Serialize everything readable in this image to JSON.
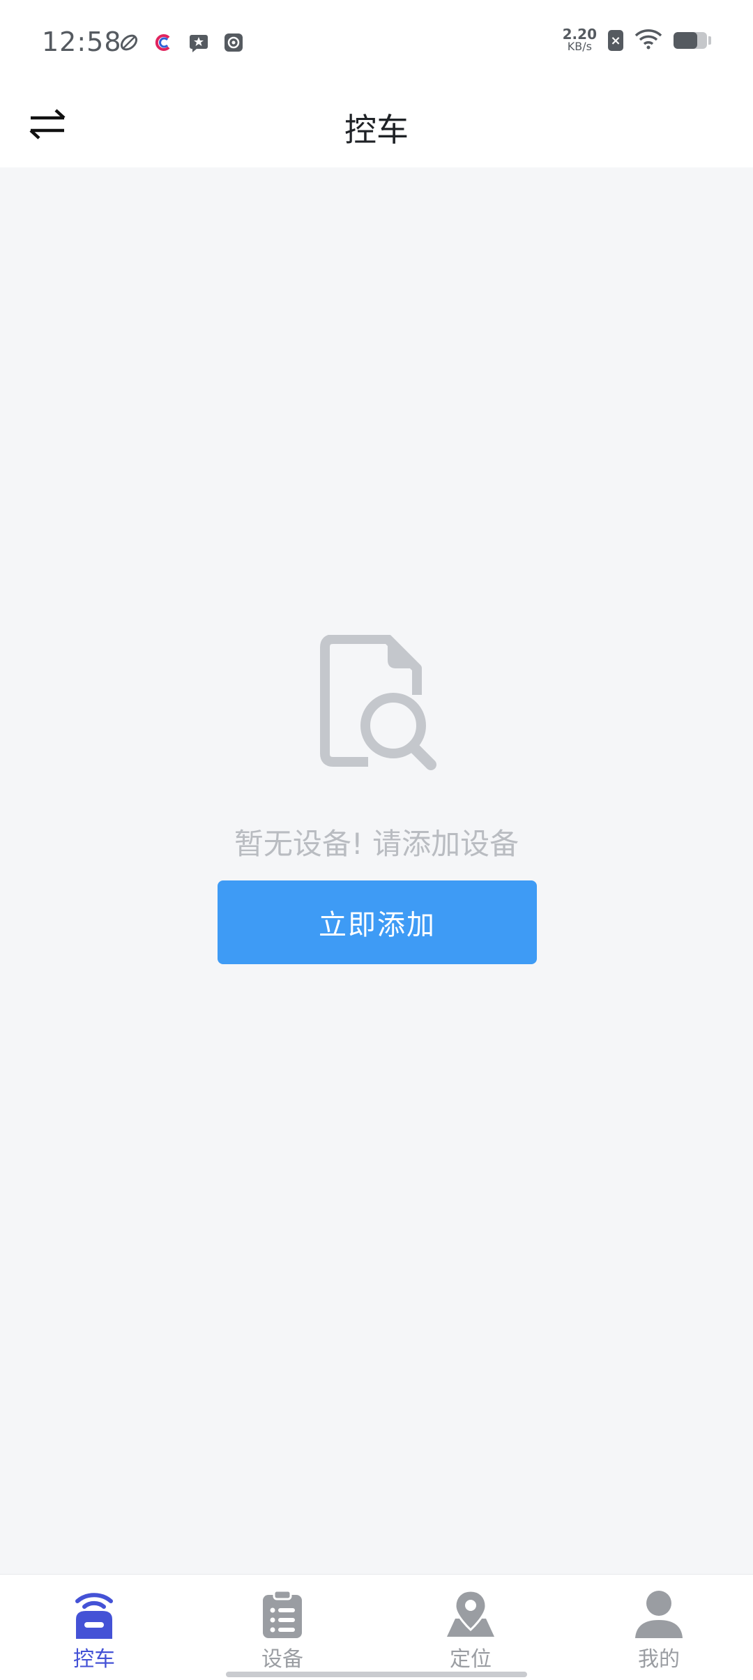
{
  "status_bar": {
    "time": "12:58",
    "net_speed_value": "2.20",
    "net_speed_unit": "KB/s",
    "sim_badge": "×",
    "battery_level": 0.7
  },
  "header": {
    "title": "控车"
  },
  "empty_state": {
    "message": "暂无设备! 请添加设备",
    "button_label": "立即添加"
  },
  "bottom_nav": {
    "items": [
      {
        "label": "控车",
        "active": true
      },
      {
        "label": "设备",
        "active": false
      },
      {
        "label": "定位",
        "active": false
      },
      {
        "label": "我的",
        "active": false
      }
    ]
  },
  "colors": {
    "accent": "#3e9bf5",
    "nav_active": "#4452d6",
    "nav_inactive": "#9a9da2",
    "background": "#f5f6f8"
  }
}
